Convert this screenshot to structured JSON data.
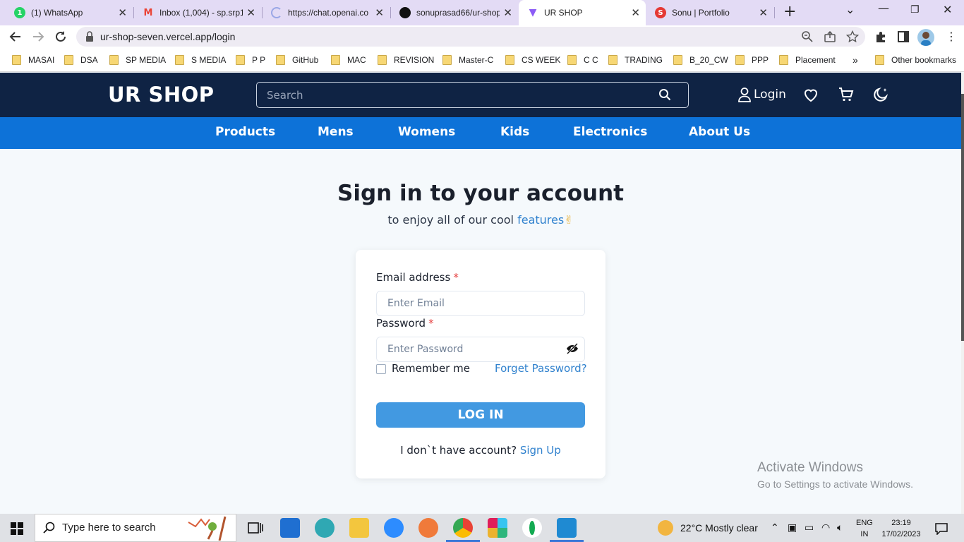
{
  "browser": {
    "tabs": [
      {
        "label": "(1) WhatsApp",
        "icon": "whatsapp-icon",
        "color": "#25d366"
      },
      {
        "label": "Inbox (1,004) - sp.srp1",
        "icon": "gmail-icon",
        "color": "#ea4335"
      },
      {
        "label": "https://chat.openai.co",
        "icon": "loading-spinner-icon",
        "color": "#9aa7e6"
      },
      {
        "label": "sonuprasad66/ur-shop",
        "icon": "github-icon",
        "color": "#111111"
      },
      {
        "label": "UR SHOP",
        "icon": "vite-icon",
        "color": "#8c5cf6"
      },
      {
        "label": "Sonu | Portfolio",
        "icon": "portfolio-icon",
        "color": "#e53935"
      }
    ],
    "url": "ur-shop-seven.vercel.app/login",
    "bookmarks": [
      "MASAI",
      "DSA",
      "SP MEDIA",
      "S MEDIA",
      "P P",
      "GitHub",
      "MAC",
      "REVISION",
      "Master-C",
      "CS WEEK",
      "C C",
      "TRADING",
      "B_20_CW",
      "PPP",
      "Placement"
    ],
    "bookmarks_overflow": "»",
    "other_bookmarks": "Other bookmarks"
  },
  "header": {
    "logo": "UR SHOP",
    "search_placeholder": "Search",
    "login_label": "Login"
  },
  "nav": {
    "items": [
      "Products",
      "Mens",
      "Womens",
      "Kids",
      "Electronics",
      "About Us"
    ]
  },
  "login": {
    "title": "Sign in to your account",
    "subtitle_prefix": "to enjoy all of our cool ",
    "subtitle_accent": "features",
    "subtitle_emoji": "✌",
    "email_label": "Email address",
    "email_placeholder": "Enter Email",
    "password_label": "Password",
    "password_placeholder": "Enter Password",
    "required_mark": "*",
    "remember_label": "Remember me",
    "forgot_label": "Forget Password?",
    "submit_label": "LOG IN",
    "no_account_text": "I don`t have account?",
    "signup_label": "Sign Up"
  },
  "watermark": {
    "line1": "Activate Windows",
    "line2": "Go to Settings to activate Windows."
  },
  "taskbar": {
    "search_placeholder": "Type here to search",
    "weather": "22°C  Mostly clear",
    "lang_1": "ENG",
    "lang_2": "IN",
    "time": "23:19",
    "date": "17/02/2023"
  },
  "colors": {
    "header_bg": "#0f2344",
    "nav_bg": "#0d72d8",
    "accent": "#3182ce",
    "button": "#4299e1",
    "required": "#e53e3e"
  }
}
